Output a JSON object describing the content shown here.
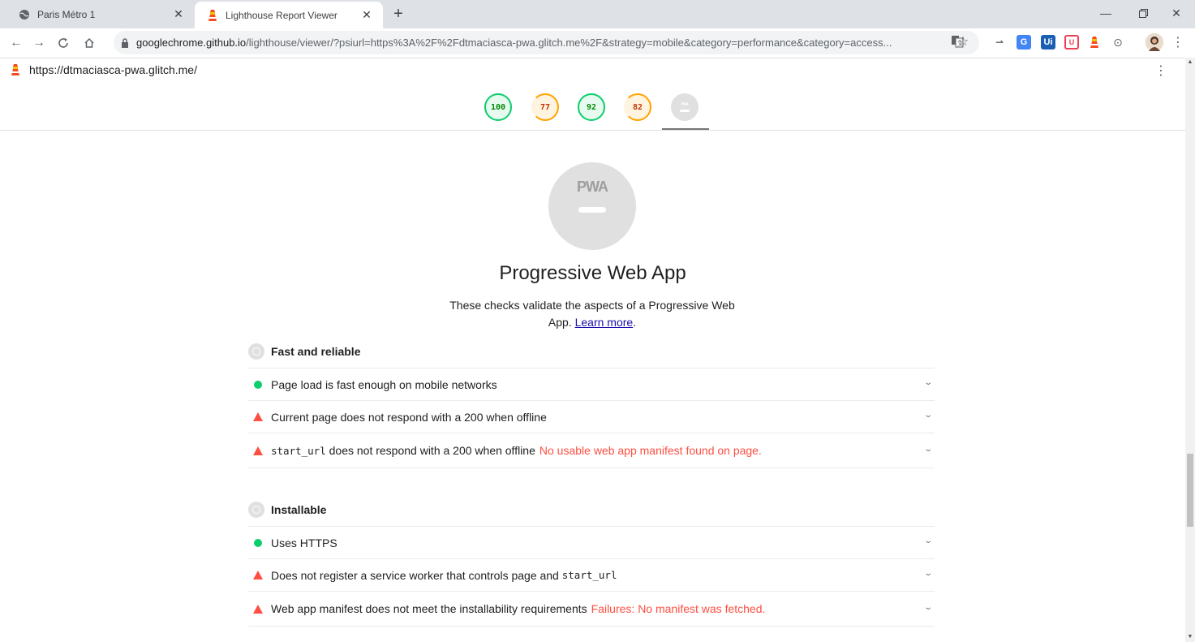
{
  "browser": {
    "tabs": [
      {
        "title": "Paris Métro 1",
        "icon": "globe-icon",
        "active": false
      },
      {
        "title": "Lighthouse Report Viewer",
        "icon": "lighthouse-icon",
        "active": true
      }
    ],
    "url_host": "googlechrome.github.io",
    "url_rest": "/lighthouse/viewer/?psiurl=https%3A%2F%2Fdtmaciasca-pwa.glitch.me%2F&strategy=mobile&category=performance&category=access...",
    "extensions": [
      "translate-icon",
      "star-icon",
      "cast-icon",
      "google-translate-ext",
      "ui-ext",
      "pocket-ext",
      "lighthouse-ext",
      "accessibility-ext",
      "profile-avatar",
      "menu-icon"
    ]
  },
  "viewer": {
    "page_url": "https://dtmaciasca-pwa.glitch.me/"
  },
  "gauges": [
    {
      "score": "100",
      "status": "pass"
    },
    {
      "score": "77",
      "status": "average"
    },
    {
      "score": "92",
      "status": "pass"
    },
    {
      "score": "82",
      "status": "average"
    },
    {
      "score": "PWA",
      "status": "pwa"
    }
  ],
  "category": {
    "badge": "PWA",
    "title": "Progressive Web App",
    "description_prefix": "These checks validate the aspects of a Progressive Web App.",
    "learn_more": "Learn more",
    "description_suffix": "."
  },
  "groups": [
    {
      "title": "Fast and reliable",
      "audits": [
        {
          "status": "pass",
          "text": "Page load is fast enough on mobile networks",
          "code": "",
          "text_after": "",
          "error": ""
        },
        {
          "status": "fail",
          "text": "Current page does not respond with a 200 when offline",
          "code": "",
          "text_after": "",
          "error": ""
        },
        {
          "status": "fail",
          "text": "",
          "code": "start_url",
          "text_after": "does not respond with a 200 when offline",
          "error": "No usable web app manifest found on page."
        }
      ]
    },
    {
      "title": "Installable",
      "audits": [
        {
          "status": "pass",
          "text": "Uses HTTPS",
          "code": "",
          "text_after": "",
          "error": ""
        },
        {
          "status": "fail",
          "text": "Does not register a service worker that controls page and",
          "code": "start_url",
          "text_after": "",
          "error": ""
        },
        {
          "status": "fail",
          "text": "Web app manifest does not meet the installability requirements",
          "code": "",
          "text_after": "",
          "error": "Failures: No manifest was fetched."
        }
      ]
    }
  ],
  "colors": {
    "pass": "#0cce6b",
    "average": "#ffa400",
    "fail": "#ff4e42",
    "pwa_gray": "#e0e0e0"
  }
}
